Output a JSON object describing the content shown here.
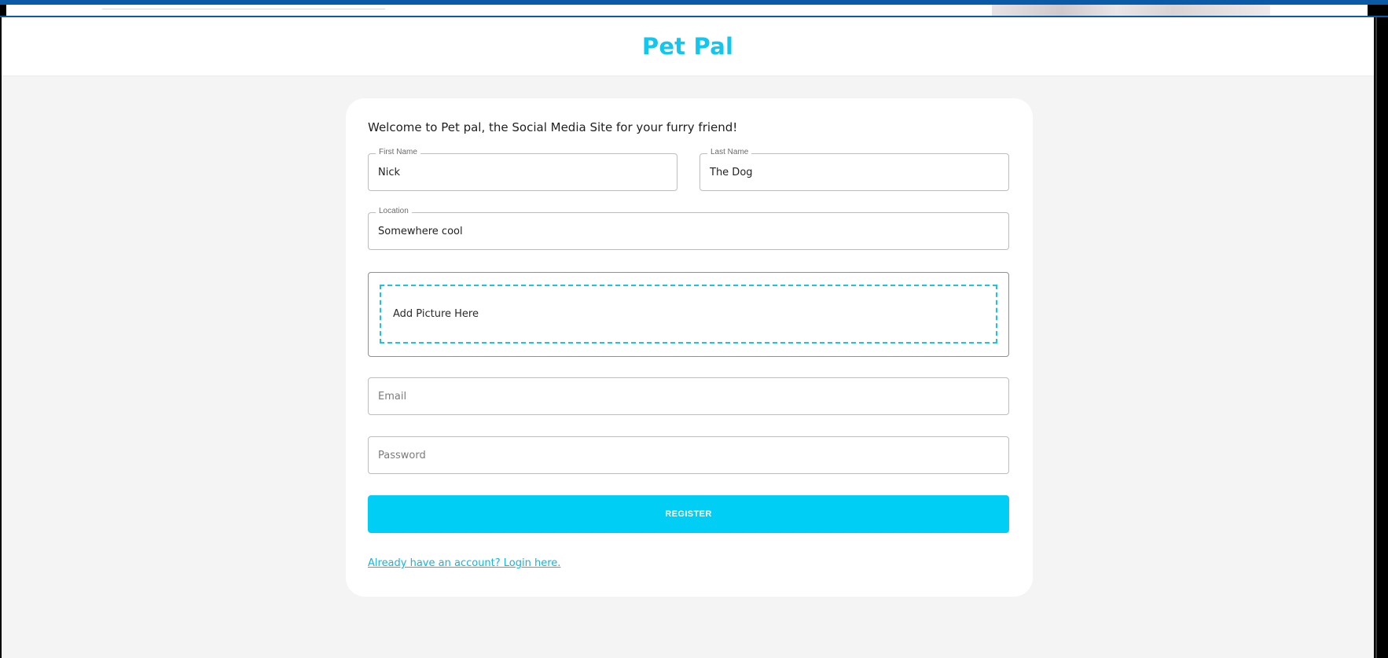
{
  "app": {
    "title": "Pet Pal",
    "accent_color": "#00cef4",
    "brand_color": "#12c7ee"
  },
  "form": {
    "welcome": "Welcome to Pet pal, the Social Media Site for your furry friend!",
    "first_name": {
      "label": "First Name",
      "value": "Nick"
    },
    "last_name": {
      "label": "Last Name",
      "value": "The Dog"
    },
    "location": {
      "label": "Location",
      "value": "Somewhere cool"
    },
    "picture": {
      "label": "Add Picture Here"
    },
    "email": {
      "placeholder": "Email",
      "value": ""
    },
    "password": {
      "placeholder": "Password",
      "value": ""
    },
    "register_label": "REGISTER",
    "login_link": "Already have an account? Login here."
  }
}
